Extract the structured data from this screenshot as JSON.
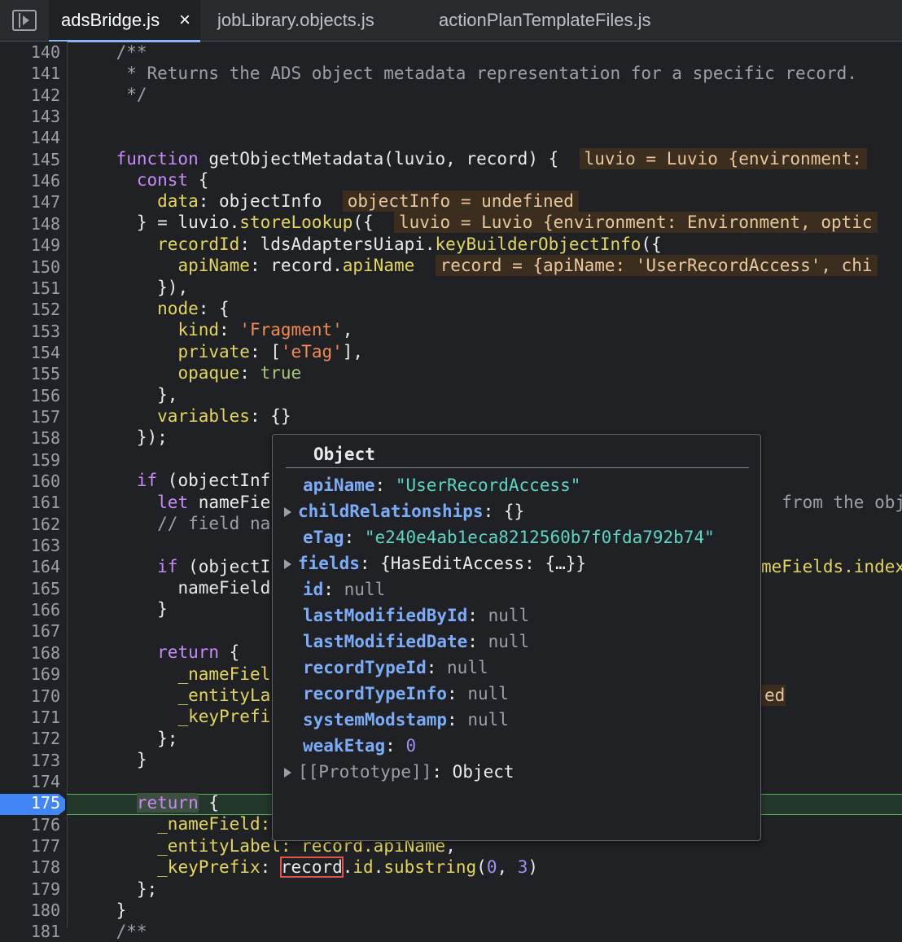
{
  "tabs": [
    {
      "label": "adsBridge.js",
      "close": "×",
      "active": true
    },
    {
      "label": "jobLibrary.objects.js"
    },
    {
      "label": "actionPlanTemplateFiles.js"
    }
  ],
  "line_numbers": [
    "140",
    "141",
    "142",
    "143",
    "144",
    "145",
    "146",
    "147",
    "148",
    "149",
    "150",
    "151",
    "152",
    "153",
    "154",
    "155",
    "156",
    "157",
    "158",
    "159",
    "160",
    "161",
    "162",
    "163",
    "164",
    "165",
    "166",
    "167",
    "168",
    "169",
    "170",
    "171",
    "172",
    "173",
    "174",
    "175",
    "176",
    "177",
    "178",
    "179",
    "180",
    "181"
  ],
  "breakpoint_line": "175",
  "code": {
    "l140": "    /**",
    "l141": "     * Returns the ADS object metadata representation for a specific record.",
    "l142": "     */",
    "l145_kw": "function",
    "l145_sig": " getObjectMetadata(luvio, record) {",
    "l145_val": "luvio = Luvio {environment:",
    "l146_kw": "const",
    "l146_rest": " {",
    "l147_prop": "data",
    "l147_rest": ": objectInfo",
    "l147_val": "objectInfo = undefined",
    "l148_a": "} = luvio.",
    "l148_prop": "storeLookup",
    "l148_b": "({",
    "l148_val": "luvio = Luvio {environment: Environment, optic",
    "l149_prop": "recordId",
    "l149_a": ": ldsAdaptersUiapi.",
    "l149_prop2": "keyBuilderObjectInfo",
    "l149_b": "({",
    "l150_prop": "apiName",
    "l150_a": ": record.",
    "l150_prop2": "apiName",
    "l150_val": "record = {apiName: 'UserRecordAccess', chi",
    "l151": "}),",
    "l152_prop": "node",
    "l152_rest": ": {",
    "l153_prop": "kind",
    "l153_a": ": ",
    "l153_str": "'Fragment'",
    "l153_b": ",",
    "l154_prop": "private",
    "l154_a": ": [",
    "l154_str": "'eTag'",
    "l154_b": "],",
    "l155_prop": "opaque",
    "l155_a": ": ",
    "l155_bool": "true",
    "l156": "},",
    "l157_prop": "variables",
    "l157_rest": ": {}",
    "l158": "});",
    "l160_kw": "if",
    "l160_rest": " (objectInf",
    "l161_kw": "let",
    "l161_rest": " nameFie",
    "l161_tail": "  from the obj",
    "l162": "// field na",
    "l164_kw": "if",
    "l164_rest": " (objectI",
    "l164_tail": "meFields.index",
    "l165": "nameField",
    "l166": "}",
    "l168_kw": "return",
    "l168_rest": " {",
    "l169": "_nameFiel",
    "l170": "_entityLa",
    "l170_tail": "ed",
    "l171": "_keyPrefi",
    "l172": "};",
    "l173": "}",
    "l175_kw": "return",
    "l175_rest": " {",
    "l176": "_nameField:",
    "l177": "_entityLabel: record.",
    "l177_prop": "apiName",
    "l177_end": ",",
    "l178_prop": "_keyPrefix",
    "l178_a": ": ",
    "l178_rec": "record",
    "l178_b": ".",
    "l178_prop2": "id",
    "l178_c": ".",
    "l178_prop3": "substring",
    "l178_d": "(",
    "l178_n1": "0",
    "l178_e": ", ",
    "l178_n2": "3",
    "l178_f": ")",
    "l179": "};",
    "l180": "}",
    "l181": "/**"
  },
  "popover": {
    "title": "Object",
    "rows": [
      {
        "key": "apiName",
        "sep": ": ",
        "value": "\"UserRecordAccess\"",
        "type": "string",
        "expandable": false
      },
      {
        "key": "childRelationships",
        "sep": ": ",
        "value": "{}",
        "type": "object",
        "expandable": true
      },
      {
        "key": "eTag",
        "sep": ": ",
        "value": "\"e240e4ab1eca8212560b7f0fda792b74\"",
        "type": "string",
        "expandable": false
      },
      {
        "key": "fields",
        "sep": ": ",
        "value": "{HasEditAccess: {…}}",
        "type": "object",
        "expandable": true
      },
      {
        "key": "id",
        "sep": ": ",
        "value": "null",
        "type": "null",
        "expandable": false
      },
      {
        "key": "lastModifiedById",
        "sep": ": ",
        "value": "null",
        "type": "null",
        "expandable": false
      },
      {
        "key": "lastModifiedDate",
        "sep": ": ",
        "value": "null",
        "type": "null",
        "expandable": false
      },
      {
        "key": "recordTypeId",
        "sep": ": ",
        "value": "null",
        "type": "null",
        "expandable": false
      },
      {
        "key": "recordTypeInfo",
        "sep": ": ",
        "value": "null",
        "type": "null",
        "expandable": false
      },
      {
        "key": "systemModstamp",
        "sep": ": ",
        "value": "null",
        "type": "null",
        "expandable": false
      },
      {
        "key": "weakEtag",
        "sep": ": ",
        "value": "0",
        "type": "number",
        "expandable": false
      },
      {
        "key": "[[Prototype]]",
        "sep": ": ",
        "value": "Object",
        "type": "proto",
        "expandable": true
      }
    ]
  }
}
